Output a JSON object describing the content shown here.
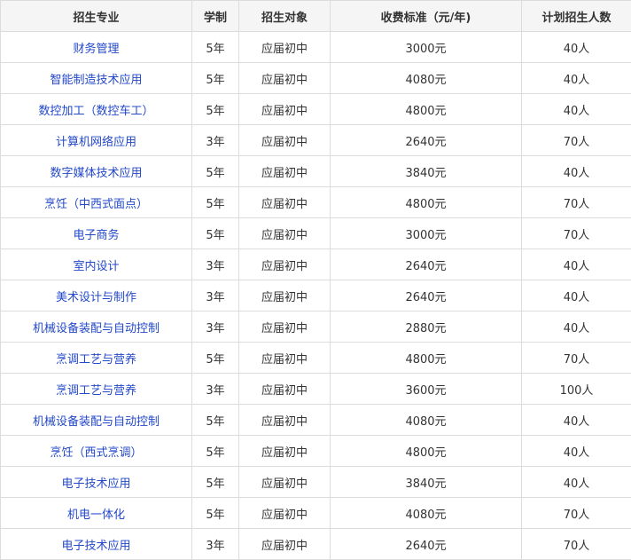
{
  "colors": {
    "link": "#2348c8",
    "header_bg": "#f5f5f5",
    "border": "#dcdcdc",
    "text": "#333333"
  },
  "table": {
    "headers": [
      "招生专业",
      "学制",
      "招生对象",
      "收费标准（元/年)",
      "计划招生人数"
    ],
    "rows": [
      [
        "财务管理",
        "5年",
        "应届初中",
        "3000元",
        "40人"
      ],
      [
        "智能制造技术应用",
        "5年",
        "应届初中",
        "4080元",
        "40人"
      ],
      [
        "数控加工（数控车工）",
        "5年",
        "应届初中",
        "4800元",
        "40人"
      ],
      [
        "计算机网络应用",
        "3年",
        "应届初中",
        "2640元",
        "70人"
      ],
      [
        "数字媒体技术应用",
        "5年",
        "应届初中",
        "3840元",
        "40人"
      ],
      [
        "烹饪（中西式面点）",
        "5年",
        "应届初中",
        "4800元",
        "70人"
      ],
      [
        "电子商务",
        "5年",
        "应届初中",
        "3000元",
        "70人"
      ],
      [
        "室内设计",
        "3年",
        "应届初中",
        "2640元",
        "40人"
      ],
      [
        "美术设计与制作",
        "3年",
        "应届初中",
        "2640元",
        "40人"
      ],
      [
        "机械设备装配与自动控制",
        "3年",
        "应届初中",
        "2880元",
        "40人"
      ],
      [
        "烹调工艺与营养",
        "5年",
        "应届初中",
        "4800元",
        "70人"
      ],
      [
        "烹调工艺与营养",
        "3年",
        "应届初中",
        "3600元",
        "100人"
      ],
      [
        "机械设备装配与自动控制",
        "5年",
        "应届初中",
        "4080元",
        "40人"
      ],
      [
        "烹饪（西式烹调）",
        "5年",
        "应届初中",
        "4800元",
        "40人"
      ],
      [
        "电子技术应用",
        "5年",
        "应届初中",
        "3840元",
        "40人"
      ],
      [
        "机电一体化",
        "5年",
        "应届初中",
        "4080元",
        "70人"
      ],
      [
        "电子技术应用",
        "3年",
        "应届初中",
        "2640元",
        "70人"
      ]
    ]
  }
}
